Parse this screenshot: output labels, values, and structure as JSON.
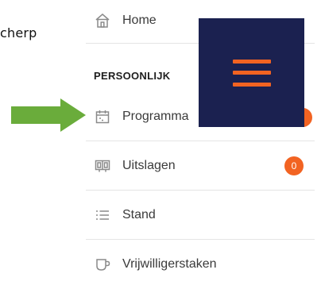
{
  "left_caption": "cherp",
  "colors": {
    "accent": "#f26322",
    "overlay_bg": "#1b2150",
    "arrow": "#6aac3b",
    "text": "#3a3a3a",
    "divider": "#e4e4e4"
  },
  "menu": {
    "home": {
      "label": "Home",
      "icon": "home-icon"
    },
    "section_title": "PERSOONLIJK",
    "items": [
      {
        "label": "Programma",
        "icon": "calendar-icon",
        "badge": ""
      },
      {
        "label": "Uitslagen",
        "icon": "scoreboard-icon",
        "badge": "0"
      },
      {
        "label": "Stand",
        "icon": "list-icon",
        "badge": ""
      },
      {
        "label": "Vrijwilligerstaken",
        "icon": "cup-icon",
        "badge": ""
      }
    ]
  },
  "overlay": {
    "icon": "hamburger-menu-icon"
  },
  "pointer": {
    "icon": "green-arrow-right-icon"
  }
}
